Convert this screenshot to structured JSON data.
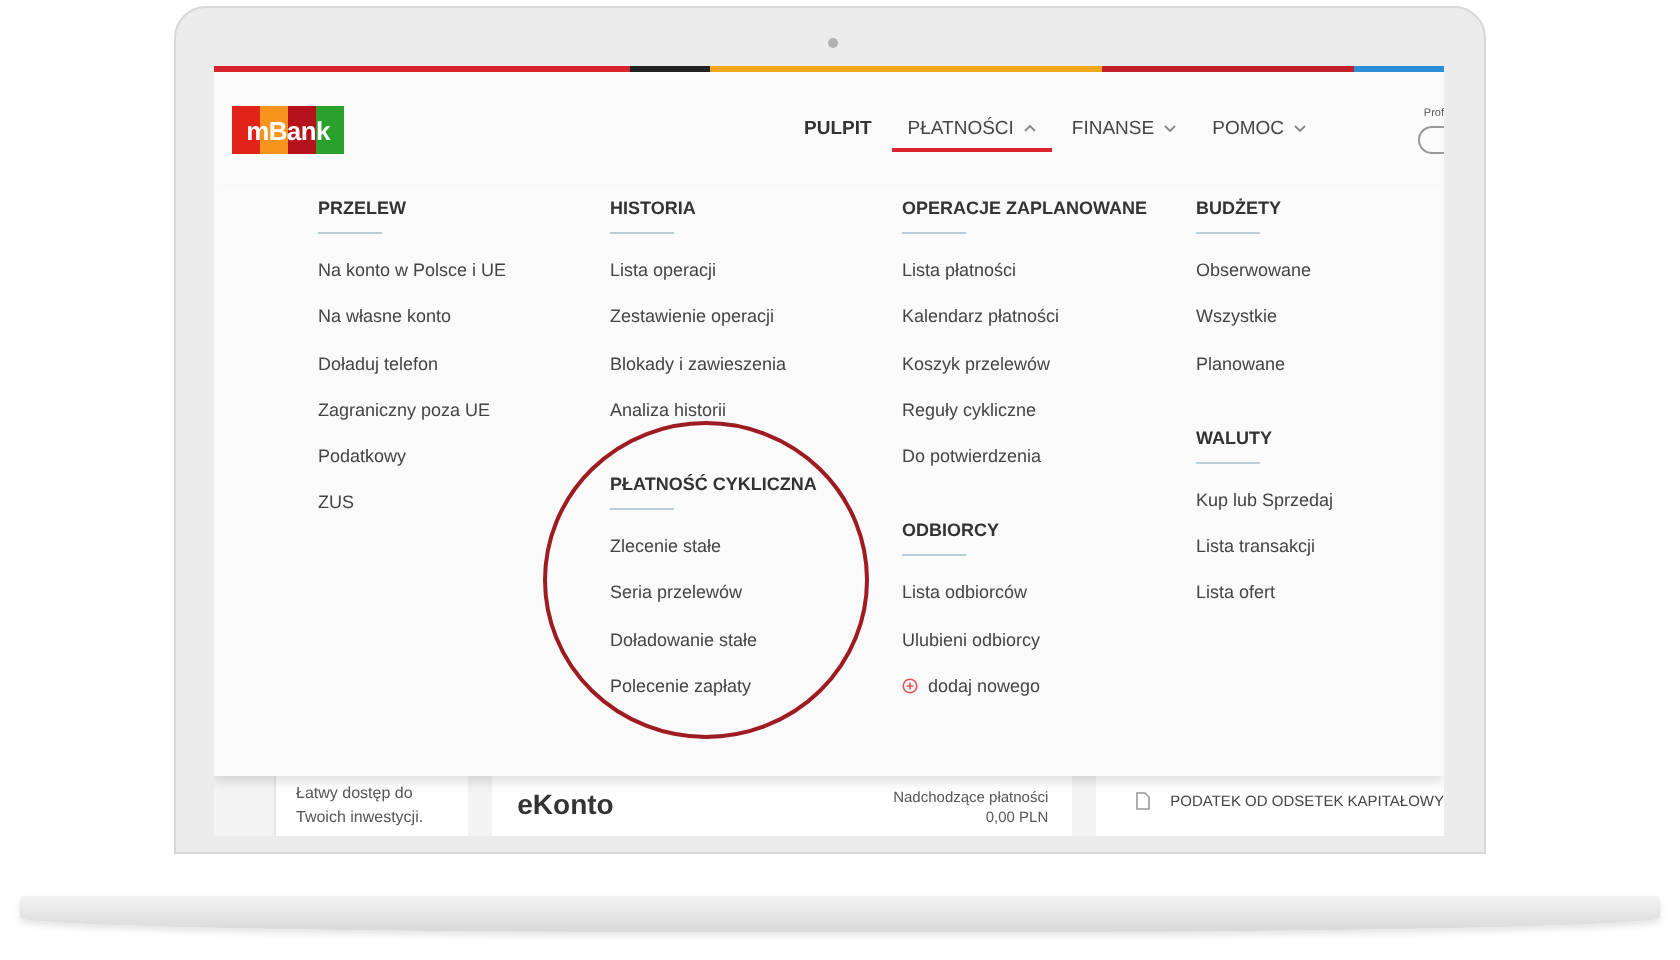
{
  "logo": {
    "text": "mBank"
  },
  "nav_tabs": [
    {
      "label": "PULPIT",
      "selected": false,
      "dropdown": false
    },
    {
      "label": "PŁATNOŚCI",
      "selected": true,
      "dropdown": true
    },
    {
      "label": "FINANSE",
      "selected": false,
      "dropdown": true
    },
    {
      "label": "POMOC",
      "selected": false,
      "dropdown": true
    }
  ],
  "profile": {
    "label": "Prof"
  },
  "menu": {
    "columns": [
      {
        "sections": [
          {
            "heading": "PRZELEW",
            "highlighted": false,
            "items": [
              {
                "label": "Na konto w Polsce i UE",
                "kind": "link"
              },
              {
                "label": "Na własne konto",
                "kind": "link"
              },
              {
                "label": "Doładuj telefon",
                "kind": "link"
              },
              {
                "label": "Zagraniczny poza UE",
                "kind": "link"
              },
              {
                "label": "Podatkowy",
                "kind": "link"
              },
              {
                "label": "ZUS",
                "kind": "link"
              }
            ]
          }
        ]
      },
      {
        "sections": [
          {
            "heading": "HISTORIA",
            "highlighted": false,
            "items": [
              {
                "label": "Lista operacji",
                "kind": "link"
              },
              {
                "label": "Zestawienie operacji",
                "kind": "link"
              },
              {
                "label": "Blokady i zawieszenia",
                "kind": "link"
              },
              {
                "label": "Analiza historii",
                "kind": "link"
              }
            ]
          },
          {
            "heading": "PŁATNOŚĆ CYKLICZNA",
            "highlighted": true,
            "items": [
              {
                "label": "Zlecenie stałe",
                "kind": "link"
              },
              {
                "label": "Seria przelewów",
                "kind": "link"
              },
              {
                "label": "Doładowanie stałe",
                "kind": "link"
              },
              {
                "label": "Polecenie zapłaty",
                "kind": "link"
              }
            ]
          }
        ]
      },
      {
        "sections": [
          {
            "heading": "OPERACJE ZAPLANOWANE",
            "highlighted": false,
            "items": [
              {
                "label": "Lista płatności",
                "kind": "link"
              },
              {
                "label": "Kalendarz płatności",
                "kind": "link"
              },
              {
                "label": "Koszyk przelewów",
                "kind": "link"
              },
              {
                "label": "Reguły cykliczne",
                "kind": "link"
              },
              {
                "label": "Do potwierdzenia",
                "kind": "link"
              }
            ]
          },
          {
            "heading": "ODBIORCY",
            "highlighted": false,
            "items": [
              {
                "label": "Lista odbiorców",
                "kind": "link"
              },
              {
                "label": "Ulubieni odbiorcy",
                "kind": "link"
              },
              {
                "label": "dodaj nowego",
                "kind": "add"
              }
            ]
          }
        ]
      },
      {
        "sections": [
          {
            "heading": "BUDŻETY",
            "highlighted": false,
            "items": [
              {
                "label": "Obserwowane",
                "kind": "link"
              },
              {
                "label": "Wszystkie",
                "kind": "link"
              },
              {
                "label": "Planowane",
                "kind": "link"
              }
            ]
          },
          {
            "heading": "WALUTY",
            "highlighted": false,
            "items": [
              {
                "label": "Kup lub Sprzedaj",
                "kind": "link"
              },
              {
                "label": "Lista transakcji",
                "kind": "link"
              },
              {
                "label": "Lista ofert",
                "kind": "link"
              }
            ]
          }
        ]
      }
    ]
  },
  "dashboard": {
    "promo_text": "Łatwy dostęp do Twoich inwestycji.",
    "account_name": "eKonto",
    "upcoming_label": "Nadchodzące płatności",
    "upcoming_amount": "0,00 PLN",
    "notice": "PODATEK OD ODSETEK KAPITAŁOWY"
  }
}
